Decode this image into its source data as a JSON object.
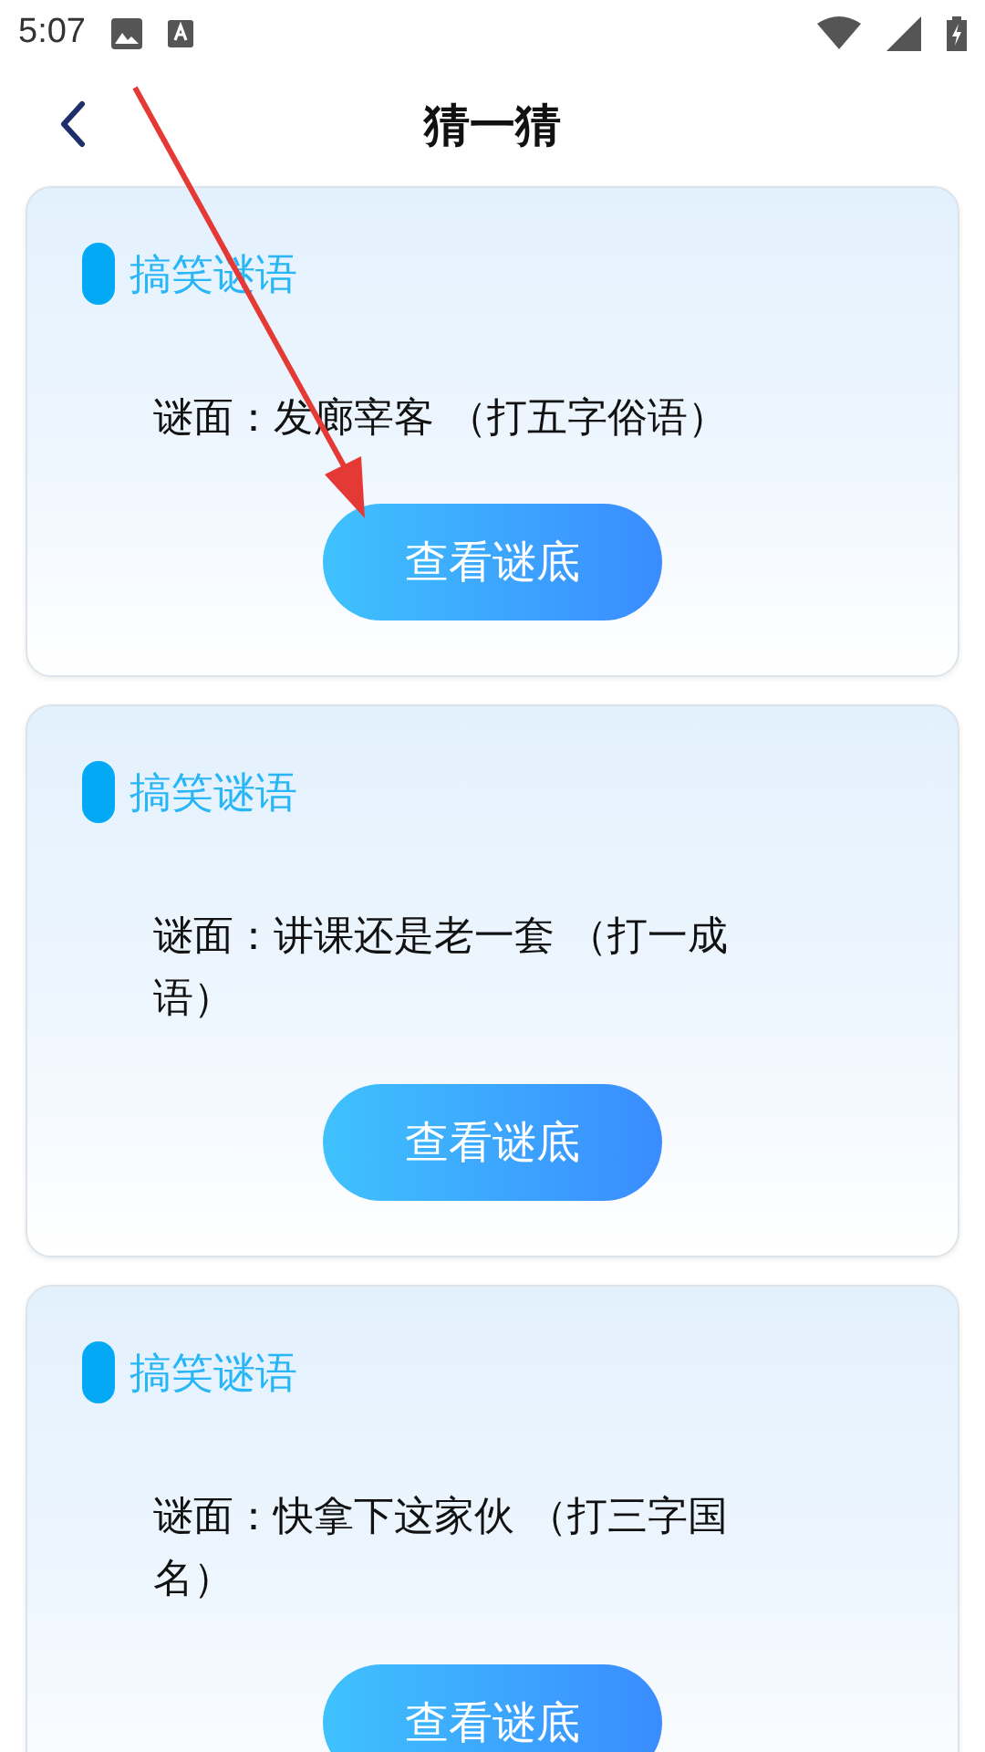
{
  "status_bar": {
    "time": "5:07"
  },
  "header": {
    "title": "猜一猜"
  },
  "cards": [
    {
      "tag": "搞笑谜语",
      "riddle": "谜面：发廊宰客 （打五字俗语）",
      "button": "查看谜底"
    },
    {
      "tag": "搞笑谜语",
      "riddle": "谜面：讲课还是老一套 （打一成语）",
      "button": "查看谜底"
    },
    {
      "tag": "搞笑谜语",
      "riddle": "谜面：快拿下这家伙 （打三字国名）",
      "button": "查看谜底"
    }
  ]
}
